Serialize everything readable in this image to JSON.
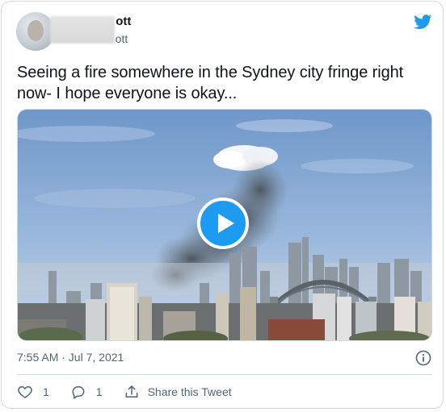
{
  "author": {
    "name_visible_suffix": "ott",
    "handle_visible_suffix": "ott"
  },
  "icons": {
    "brand": "twitter-bird-icon",
    "info": "info-icon",
    "like": "heart-icon",
    "reply": "reply-bubble-icon",
    "share": "share-upload-icon",
    "play": "play-icon"
  },
  "tweet": {
    "text": "Seeing a fire somewhere in the Sydney city fringe right now- I hope everyone is okay...",
    "timestamp": "7:55 AM · Jul 7, 2021"
  },
  "actions": {
    "like_count": "1",
    "reply_count": "1",
    "share_label": "Share this Tweet"
  },
  "colors": {
    "brand_blue": "#1d9bf0",
    "text_secondary": "#536471",
    "border": "#cfd9de"
  }
}
